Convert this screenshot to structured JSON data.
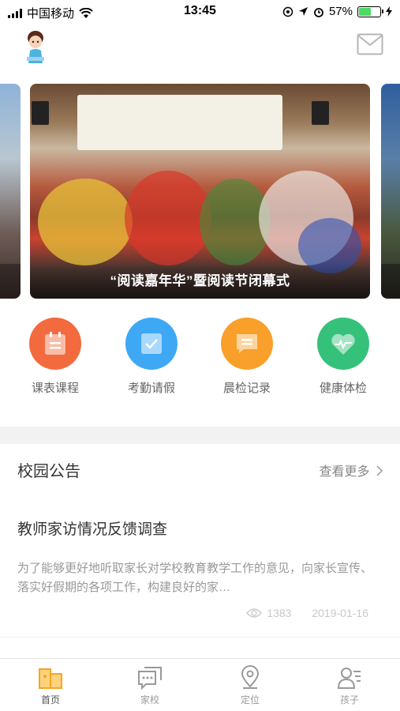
{
  "status_bar": {
    "carrier": "中国移动",
    "time": "13:45",
    "battery": "57%",
    "battery_level": 0.57
  },
  "carousel": {
    "caption": "“阅读嘉年华”暨阅读节闭幕式"
  },
  "quick_actions": [
    {
      "label": "课表课程",
      "color": "#f26a3d"
    },
    {
      "label": "考勤请假",
      "color": "#3ea8f5"
    },
    {
      "label": "晨检记录",
      "color": "#f9a02a"
    },
    {
      "label": "健康体检",
      "color": "#35c17a"
    }
  ],
  "notice": {
    "section_title": "校园公告",
    "more_label": "查看更多",
    "article_title": "教师家访情况反馈调查",
    "article_body": "为了能够更好地听取家长对学校教育教学工作的意见，向家长宣传、落实好假期的各项工作，构建良好的家…",
    "views": "1383",
    "date": "2019-01-16"
  },
  "tabbar": {
    "items": [
      {
        "label": "首页",
        "icon": "home-icon",
        "active": true
      },
      {
        "label": "家校",
        "icon": "chat-icon",
        "active": false
      },
      {
        "label": "定位",
        "icon": "location-icon",
        "active": false
      },
      {
        "label": "孩子",
        "icon": "child-profile-icon",
        "active": false
      }
    ],
    "active_color": "#f5a623"
  }
}
